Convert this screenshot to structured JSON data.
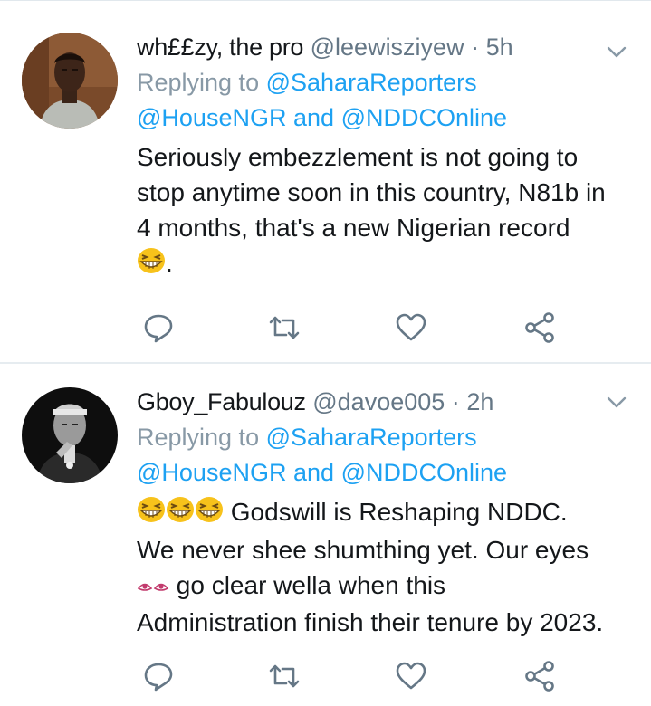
{
  "tweets": [
    {
      "name": "wh££zy, the pro",
      "handle": "@leewisziyew",
      "separator": "·",
      "time": "5h",
      "replying_prefix": "Replying to",
      "reply_to_1": "@SaharaReporters",
      "reply_to_2": "@HouseNGR",
      "and_word": "and",
      "reply_to_3": "@NDDCOnline",
      "body_line1": "Seriously embezzlement is not going to",
      "body_line2": "stop anytime soon in this country, N81b in",
      "body_line3": "4 months, that's a new Nigerian record",
      "body_tail": ".",
      "emoji_icon": "grinning-squinting-face-icon",
      "avatar_icon": "man-in-grey-shirt-avatar"
    },
    {
      "name": "Gboy_Fabulouz",
      "handle": "@davoe005",
      "separator": "·",
      "time": "2h",
      "replying_prefix": "Replying to",
      "reply_to_1": "@SaharaReporters",
      "reply_to_2": "@HouseNGR",
      "and_word": "and",
      "reply_to_3": "@NDDCOnline",
      "body_line1": "Godswill is Reshaping NDDC.",
      "body_line2": "We never shee shumthing yet. Our eyes",
      "body_line3": "go clear wella when this",
      "body_line4": "Administration finish their tenure by 2023.",
      "emoji_icon": "grinning-squinting-face-icon",
      "eyes_icon": "eyes-icon",
      "avatar_icon": "black-and-white-portrait-avatar"
    }
  ],
  "icons": {
    "reply": "reply-bubble-icon",
    "retweet": "retweet-icon",
    "like": "heart-icon",
    "share": "share-icon",
    "caret": "chevron-down-icon"
  },
  "colors": {
    "link": "#1da1f2",
    "muted": "#657786",
    "text": "#14171a",
    "icon": "#657786",
    "divider": "#e6ecf0"
  }
}
